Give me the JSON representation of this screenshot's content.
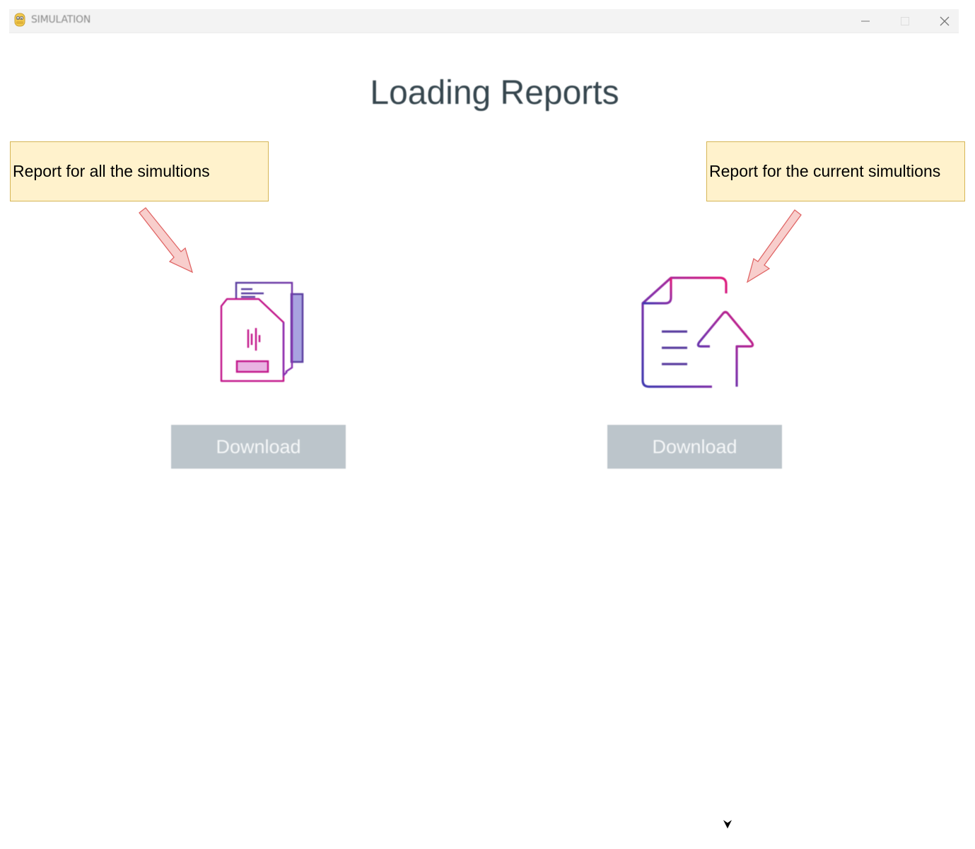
{
  "window": {
    "title": "SIMULATION",
    "app_icon": "python-icon",
    "controls": [
      "minimize-icon",
      "maximize-icon",
      "close-icon"
    ]
  },
  "main": {
    "heading": "Loading Reports",
    "left": {
      "callout": "Report for all the simultions",
      "icon": "multiple-documents-icon",
      "button_label": "Download"
    },
    "right": {
      "callout": "Report for the current simultions",
      "icon": "document-upload-icon",
      "button_label": "Download"
    }
  },
  "colors": {
    "heading": "#37474f",
    "callout_fill": "#fff2cc",
    "callout_border": "#d6b656",
    "arrow_fill": "#f8cecc",
    "arrow_stroke": "#e06666",
    "button_fill": "#bcc5cb",
    "button_text": "#f5f7f8",
    "icon_magenta": "#c2188b",
    "icon_purple": "#5b3fa0"
  }
}
